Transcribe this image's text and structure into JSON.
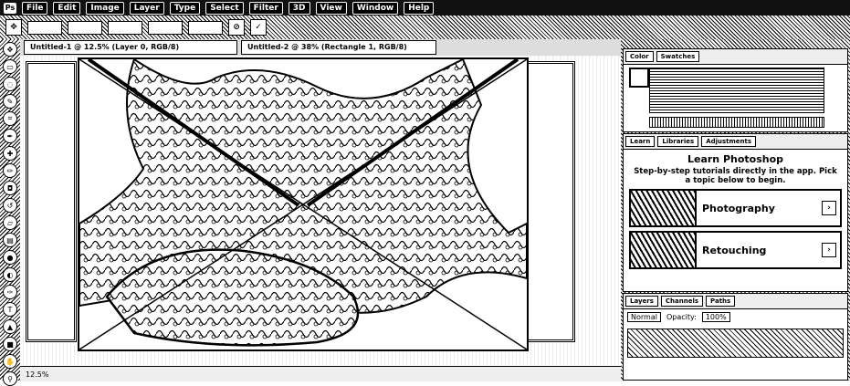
{
  "menubar": {
    "logo": "Ps",
    "items": [
      "File",
      "Edit",
      "Image",
      "Layer",
      "Type",
      "Select",
      "Filter",
      "3D",
      "View",
      "Window",
      "Help"
    ]
  },
  "options": {
    "fields": [
      "",
      "",
      "",
      "",
      ""
    ]
  },
  "documents": {
    "tabs": [
      {
        "title": "Untitled-1 @ 12.5% (Layer 0, RGB/8)"
      },
      {
        "title": "Untitled-2 @ 38% (Rectangle 1, RGB/8)"
      }
    ]
  },
  "status": {
    "zoom": "12.5%"
  },
  "panels": {
    "color_tabs": [
      "Color",
      "Swatches"
    ],
    "learn_tabs": [
      "Learn",
      "Libraries",
      "Adjustments"
    ],
    "learn": {
      "title": "Learn Photoshop",
      "description": "Step-by-step tutorials directly in the app. Pick a topic below to begin.",
      "cards": [
        "Photography",
        "Retouching"
      ]
    },
    "layer_tabs": [
      "Layers",
      "Channels",
      "Paths"
    ],
    "layers": {
      "kind": "Normal",
      "opacity_label": "Opacity:",
      "opacity": "100%"
    }
  },
  "icons": {
    "close": "close-icon",
    "arrow": "chevron-right-icon"
  }
}
